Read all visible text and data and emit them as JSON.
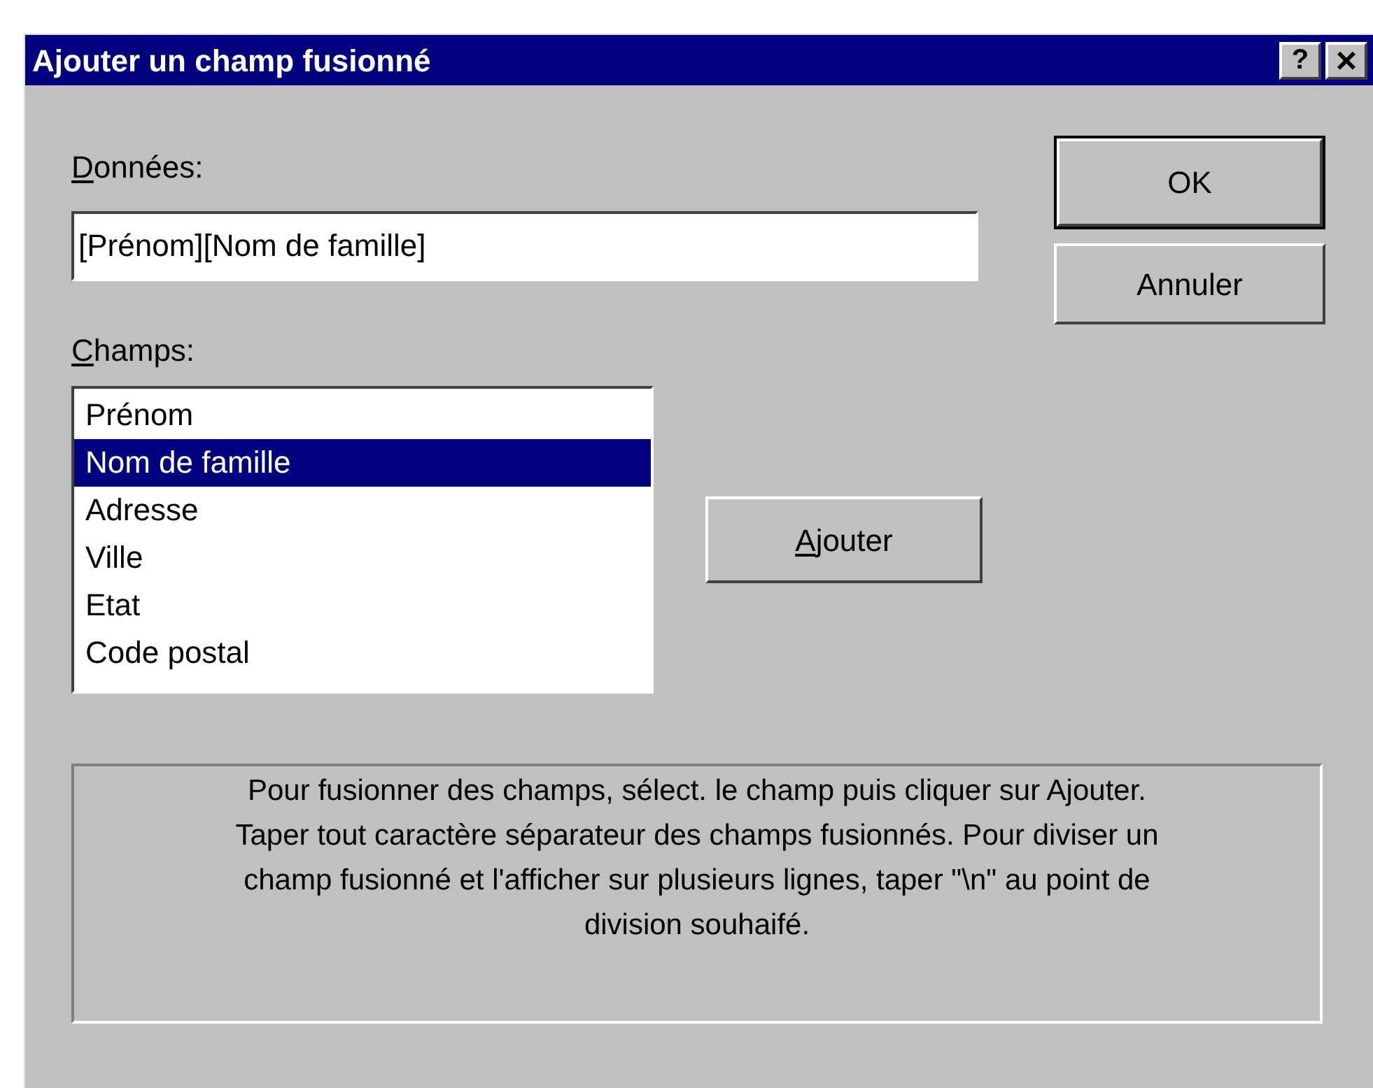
{
  "window": {
    "title": "Ajouter un champ fusionné",
    "help_button": "?",
    "close_button": "×"
  },
  "data_field": {
    "label": "Données:",
    "underline_first": true,
    "value": "[Prénom][Nom de famille]"
  },
  "buttons": [
    {
      "label": "OK",
      "default": true
    },
    {
      "label": "Annuler",
      "default": false
    }
  ],
  "fields_list": {
    "label": "Champs:",
    "underline_first": true,
    "items": [
      {
        "label": "Prénom",
        "selected": false
      },
      {
        "label": "Nom de famille",
        "selected": true
      },
      {
        "label": "Adresse",
        "selected": false
      },
      {
        "label": "Ville",
        "selected": false
      },
      {
        "label": "Etat",
        "selected": false
      },
      {
        "label": "Code postal",
        "selected": false
      }
    ]
  },
  "add_button": {
    "label": "Ajouter",
    "underline_first": true
  },
  "help_text": [
    "Pour fusionner des champs, sélect. le champ puis cliquer sur Ajouter.",
    "Taper tout caractère séparateur des champs fusionnés. Pour diviser un",
    "champ fusionné et l'afficher sur plusieurs lignes, taper \"\\n\" au point de",
    "division souhaifé."
  ]
}
